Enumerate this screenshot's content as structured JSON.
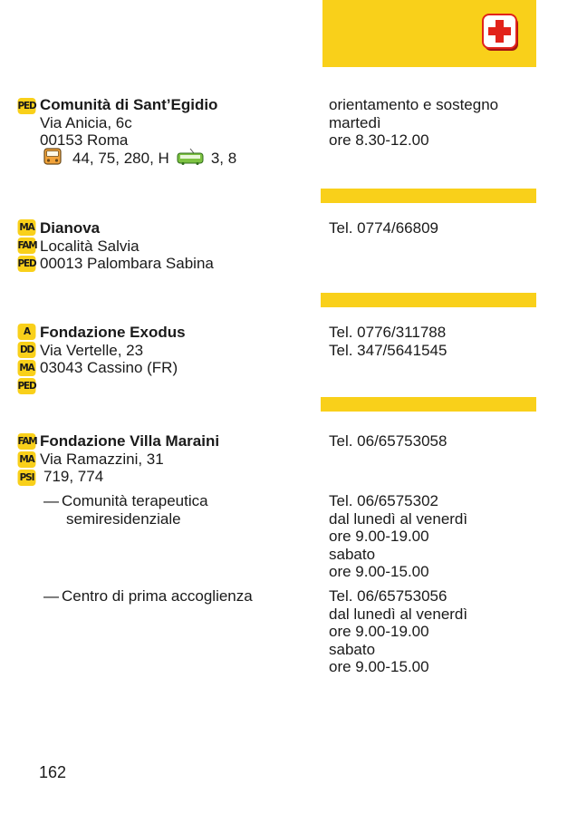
{
  "entries": [
    {
      "badges": [
        "PED"
      ],
      "name": "Comunità di Sant’Egidio",
      "address": [
        "Via Anicia, 6c",
        "00153 Roma"
      ],
      "bus_lines": "44, 75, 280, H",
      "tram_lines": "3, 8",
      "right": [
        "orientamento e sostegno",
        "martedì",
        "ore 8.30-12.00"
      ]
    },
    {
      "badges": [
        "MA",
        "FAM",
        "PED"
      ],
      "name": "Dianova",
      "address": [
        "Località Salvia",
        "00013 Palombara Sabina"
      ],
      "right": [
        "Tel. 0774/66809"
      ]
    },
    {
      "badges": [
        "A",
        "DD",
        "MA",
        "PED"
      ],
      "name": "Fondazione Exodus",
      "address": [
        "Via Vertelle, 23",
        "03043 Cassino (FR)"
      ],
      "right": [
        "Tel. 0776/311788",
        "Tel. 347/5641545"
      ]
    },
    {
      "badges": [
        "FAM",
        "MA",
        "PSI"
      ],
      "name": "Fondazione Villa Maraini",
      "address": [
        "Via Ramazzini, 31",
        "719, 774"
      ],
      "right": [
        "Tel. 06/65753058"
      ],
      "sub_services": [
        {
          "label_lines": [
            "Comunità terapeutica",
            "semiresidenziale"
          ],
          "right": [
            "Tel. 06/6575302",
            "dal lunedì al venerdì",
            "ore 9.00-19.00",
            "sabato",
            "ore 9.00-15.00"
          ]
        },
        {
          "label_lines": [
            "Centro di prima accoglienza"
          ],
          "right": [
            "Tel. 06/65753056",
            "dal lunedì al venerdì",
            "ore 9.00-19.00",
            "sabato",
            "ore 9.00-15.00"
          ]
        }
      ]
    }
  ],
  "sub_dash": "—",
  "page_number": "162",
  "icons": {
    "first_aid": "first-aid-icon",
    "bus": "bus-icon",
    "tram": "tram-icon"
  },
  "colors": {
    "accent_yellow": "#f9d01a",
    "first_aid_red": "#e2231a"
  }
}
